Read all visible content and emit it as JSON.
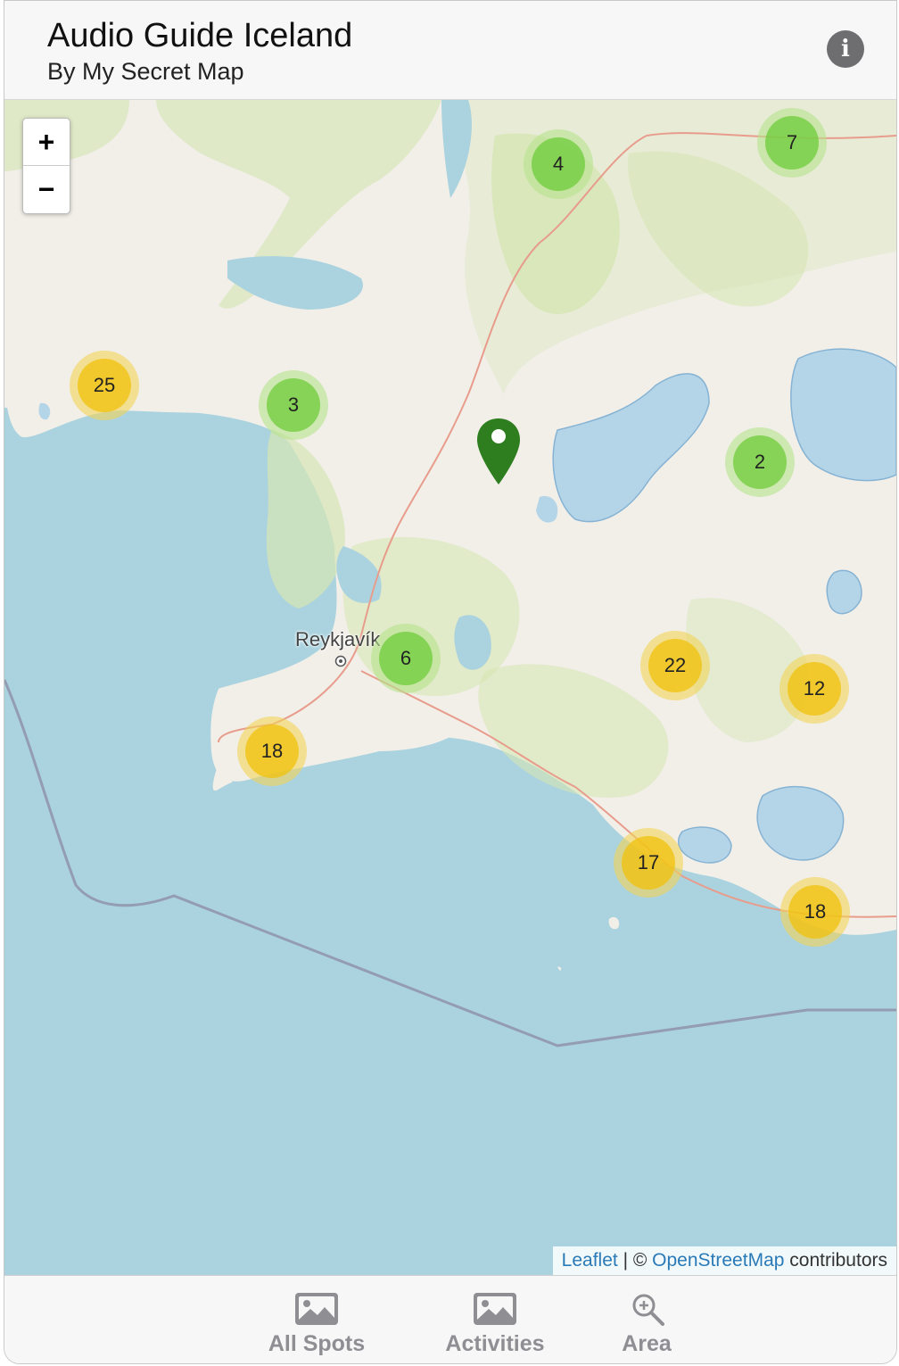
{
  "header": {
    "title": "Audio Guide Iceland",
    "subtitle": "By My Secret Map",
    "info_icon": "info-icon"
  },
  "map": {
    "zoom_in_label": "+",
    "zoom_out_label": "−",
    "city": "Reykjavík",
    "clusters": [
      {
        "count": "4",
        "color": "green"
      },
      {
        "count": "7",
        "color": "green"
      },
      {
        "count": "25",
        "color": "yellow"
      },
      {
        "count": "3",
        "color": "green"
      },
      {
        "count": "2",
        "color": "green"
      },
      {
        "count": "6",
        "color": "green"
      },
      {
        "count": "22",
        "color": "yellow"
      },
      {
        "count": "12",
        "color": "yellow"
      },
      {
        "count": "18",
        "color": "yellow"
      },
      {
        "count": "17",
        "color": "yellow"
      },
      {
        "count": "18",
        "color": "yellow"
      }
    ],
    "attribution": {
      "leaflet": "Leaflet",
      "separator": " | © ",
      "osm": "OpenStreetMap",
      "suffix": " contributors"
    }
  },
  "tabs": [
    {
      "label": "All Spots",
      "icon": "photo-icon"
    },
    {
      "label": "Activities",
      "icon": "photo-icon"
    },
    {
      "label": "Area",
      "icon": "magnifier-icon"
    }
  ],
  "colors": {
    "sea": "#aad3df",
    "land": "#f2efe9",
    "cluster_green": "#6ecc39",
    "cluster_yellow": "#f0c20c",
    "pin": "#2e7d1f",
    "tab_gray": "#8e8e93"
  }
}
